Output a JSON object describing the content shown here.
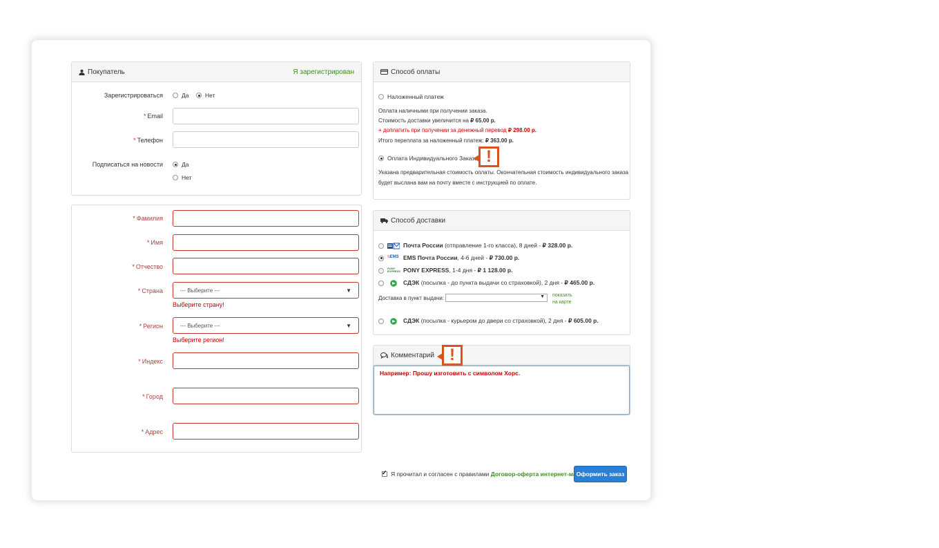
{
  "buyer": {
    "title": "Покупатель",
    "registered_link": "Я зарегистрирован",
    "register_label": "Зарегистрироваться",
    "register_yes": "Да",
    "register_no": "Нет",
    "email_label": "Email",
    "phone_label": "Телефон",
    "subscribe_label": "Подписаться на новости",
    "subscribe_yes": "Да",
    "subscribe_no": "Нет",
    "required_mark": "*"
  },
  "address": {
    "last_name_label": "Фамилия",
    "first_name_label": "Имя",
    "middle_name_label": "Отчество",
    "country_label": "Страна",
    "country_value": "--- Выберите ---",
    "country_error": "Выберите страну!",
    "region_label": "Регион",
    "region_value": "--- Выберите ---",
    "region_error": "Выберите регион!",
    "zip_label": "Индекс",
    "city_label": "Город",
    "street_label": "Адрес"
  },
  "payment": {
    "title": "Способ оплаты",
    "cod_label": "Наложенный платеж",
    "cod_line1": "Оплата наличными при получении заказа.",
    "cod_line2_prefix": "Стоимость доставки увеличится на",
    "cod_line2_value": "₽ 65.00 р.",
    "cod_line3_prefix": "+ доплатить при получении за денежный перевод",
    "cod_line3_value": "₽ 298.00 р.",
    "cod_line4_prefix": "Итого переплата за наложенный платеж:",
    "cod_line4_value": "₽ 363.00 р.",
    "individual_label": "Оплата Индивидуального Заказа",
    "individual_desc1": "Указана предварительная стоимость оплаты. Окончательная стоимость индивидуального заказа",
    "individual_desc2": "будет выслана вам на почту вместе с инструкцией по оплате."
  },
  "delivery": {
    "title": "Способ доставки",
    "options": [
      {
        "name": "Почта России",
        "desc": " (отправление 1-го класса), 8 дней - ",
        "price": "₽ 328.00 р."
      },
      {
        "name": "EMS Почта России",
        "desc": ", 4-6 дней - ",
        "price": "₽ 730.00 р."
      },
      {
        "name": "PONY EXPRESS",
        "desc": ", 1-4 дня - ",
        "price": "₽ 1 128.00 р."
      },
      {
        "name": "СДЭК",
        "desc": " (посылка - до пункта выдачи со страховкой), 2 дня - ",
        "price": "₽ 465.00 р."
      },
      {
        "name": "СДЭК",
        "desc": " (посылка - курьером до двери со страховкой), 2 дня - ",
        "price": "₽ 605.00 р."
      }
    ],
    "pickup_label": "Доставка в пункт выдачи:",
    "map_link_line1": "показать",
    "map_link_line2": "на карте",
    "logo_ems": "EMS",
    "logo_pony_line1": "PONY",
    "logo_pony_line2": "EXPRESS"
  },
  "comment": {
    "title": "Комментарий",
    "value": "Например: Прошу изготовить с символом Хорс."
  },
  "footer": {
    "agree_prefix": "Я прочитал и согласен с правилами",
    "agree_link": "Договор-оферта интернет-магазина",
    "submit": "Оформить заказ"
  },
  "warn_mark": "!",
  "colors": {
    "accent": "#2b7fd4",
    "error": "#cc0000",
    "link": "#3f8f1f",
    "warning": "#d9531e"
  }
}
